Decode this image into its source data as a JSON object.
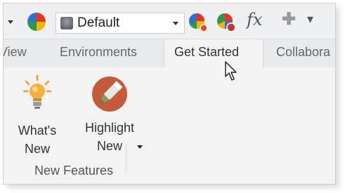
{
  "toolbar": {
    "appearance_selector": {
      "value": "Default"
    },
    "icons": [
      "dropdown-arrow-icon",
      "color-wheel-icon",
      "appearance-swatch-icon",
      "appearance-dropdown-icon",
      "appearance-manager-icon",
      "appearance-palette-icon",
      "function-fx-icon",
      "add-plus-icon",
      "customize-menu-icon"
    ],
    "fx_label": "fx"
  },
  "tabs": [
    {
      "label": "View"
    },
    {
      "label": "Environments"
    },
    {
      "label": "Get Started",
      "active": true
    },
    {
      "label": "Collabora"
    }
  ],
  "ribbon": {
    "group_label": "New Features",
    "buttons": [
      {
        "line1": "What's",
        "line2": "New",
        "icon": "lightbulb-icon"
      },
      {
        "line1": "Highlight",
        "line2": "New",
        "icon": "highlighter-pen-icon",
        "has_dropdown": true
      }
    ]
  },
  "colors": {
    "accent_orange": "#f29a2e",
    "highlight_circle": "#c45c3a",
    "toolbar_bg": "#eef0f1",
    "tab_bar_bg": "#e8eaec",
    "ribbon_bg": "#f3f3f3"
  }
}
